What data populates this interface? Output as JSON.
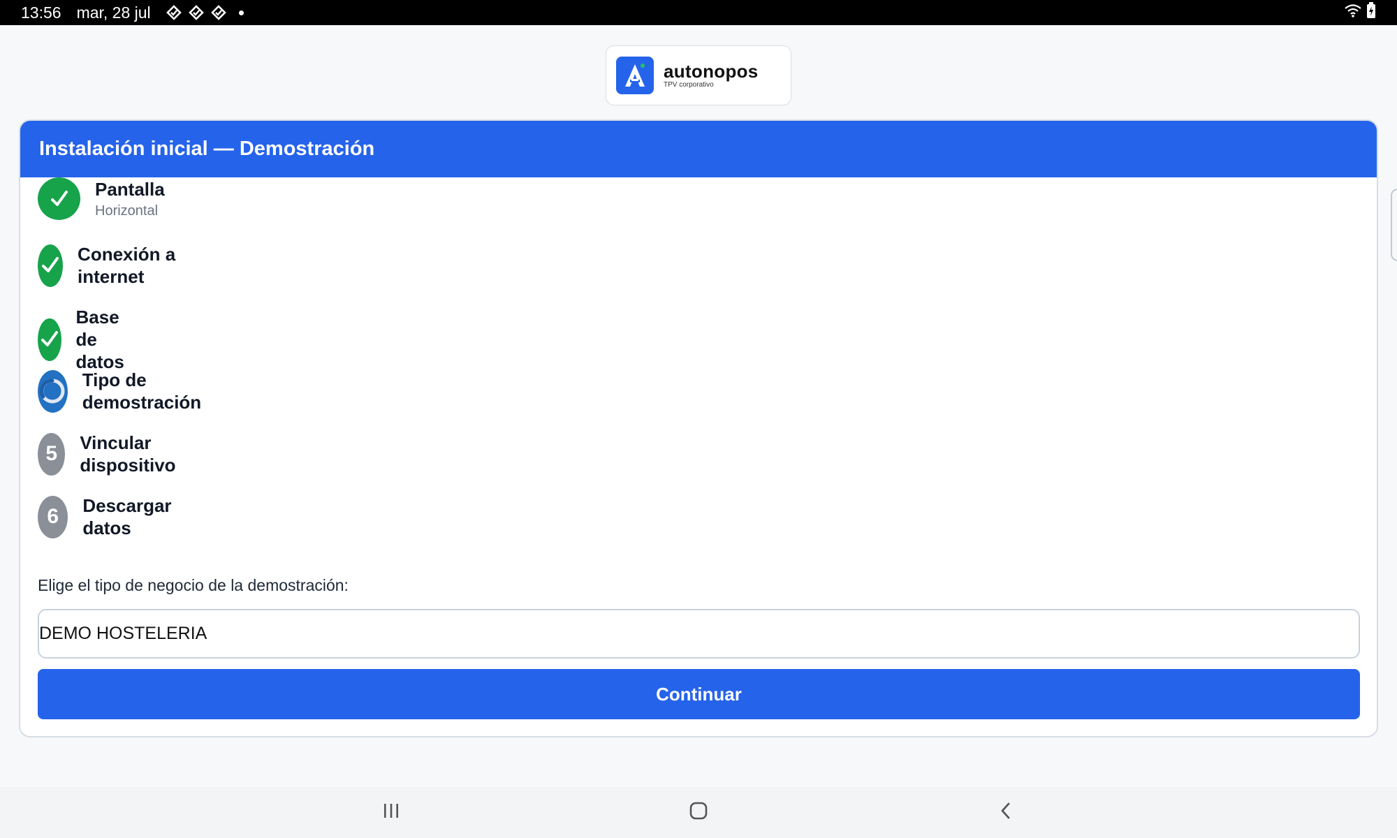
{
  "status_bar": {
    "time": "13:56",
    "date": "mar, 28 jul",
    "notification_icons": [
      "app-notification-icon",
      "app-notification-icon",
      "app-notification-icon"
    ],
    "right_icons": [
      "wifi-icon",
      "battery-icon"
    ]
  },
  "logo": {
    "mark_letter": "A",
    "name": "autonopos",
    "subtitle": "TPV corporativo"
  },
  "card": {
    "title": "Instalación inicial — Demostración",
    "steps": [
      {
        "label": "Pantalla",
        "sub": "Horizontal",
        "state": "done",
        "icon": "check-icon"
      },
      {
        "label": "Conexión a internet",
        "state": "done",
        "icon": "check-icon"
      },
      {
        "label": "Base de datos",
        "state": "done",
        "icon": "check-icon"
      },
      {
        "label": "Tipo de demostración",
        "state": "active",
        "icon": "spinner-icon"
      },
      {
        "label": "Vincular dispositivo",
        "state": "pending",
        "number": "5"
      },
      {
        "label": "Descargar datos",
        "state": "pending",
        "number": "6"
      }
    ],
    "prompt": "Elige el tipo de negocio de la demostración:",
    "selected_value": "DEMO HOSTELERIA",
    "continue_label": "Continuar"
  },
  "colors": {
    "primary": "#2563eb",
    "done": "#16a34a",
    "active": "#2271c3",
    "pending": "#8a8f98"
  },
  "nav_bar": {
    "buttons": [
      "recent-apps-icon",
      "home-icon",
      "back-icon"
    ]
  }
}
